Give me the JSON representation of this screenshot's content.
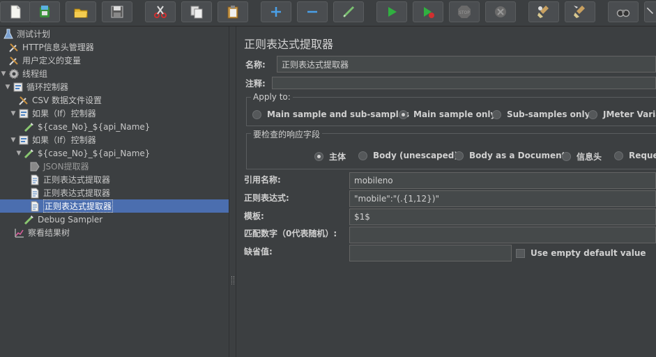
{
  "toolbar": {
    "buttons": [
      "new-icon",
      "templates-icon",
      "open-icon",
      "save-icon",
      "cut-icon",
      "copy-icon",
      "paste-icon",
      "expand-icon",
      "collapse-icon",
      "toggle-icon",
      "start-icon",
      "start-no-pauses-icon",
      "stop-icon",
      "shutdown-icon",
      "clear-icon",
      "clear-all-icon",
      "search-icon"
    ]
  },
  "tree": {
    "items": [
      {
        "label": "测试计划"
      },
      {
        "label": "HTTP信息头管理器"
      },
      {
        "label": "用户定义的变量"
      },
      {
        "label": "线程组"
      },
      {
        "label": "循环控制器"
      },
      {
        "label": "CSV 数据文件设置"
      },
      {
        "label": "如果（If）控制器"
      },
      {
        "label": "${case_No}_${api_Name}"
      },
      {
        "label": "如果（If）控制器"
      },
      {
        "label": "${case_No}_${api_Name}"
      },
      {
        "label": "JSON提取器"
      },
      {
        "label": "正则表达式提取器"
      },
      {
        "label": "正则表达式提取器"
      },
      {
        "label": "正则表达式提取器"
      },
      {
        "label": "Debug Sampler"
      },
      {
        "label": "察看结果树"
      }
    ]
  },
  "panel": {
    "title": "正则表达式提取器",
    "name_label": "名称:",
    "name_value": "正则表达式提取器",
    "comments_label": "注释:",
    "comments_value": "",
    "apply_to": {
      "title": "Apply to:",
      "options": [
        "Main sample and sub-samples",
        "Main sample only",
        "Sub-samples only",
        "JMeter Variab"
      ],
      "selected": "Main sample only"
    },
    "field_to_check": {
      "title": "要检查的响应字段",
      "options": [
        "主体",
        "Body (unescaped)",
        "Body as a Document",
        "信息头",
        "Reques"
      ],
      "selected": "主体"
    },
    "ref_name_label": "引用名称:",
    "ref_name_value": "mobileno",
    "regex_label": "正则表达式:",
    "regex_value": "\"mobile\":\"(.{1,12})\"",
    "template_label": "模板:",
    "template_value": "$1$",
    "match_no_label": "匹配数字（0代表随机）:",
    "match_no_value": "",
    "default_label": "缺省值:",
    "default_value": "",
    "use_empty_default_label": "Use empty default value"
  },
  "colors": {
    "background": "#3c3f41",
    "selection": "#4b6eaf",
    "input_bg": "#45494a"
  }
}
